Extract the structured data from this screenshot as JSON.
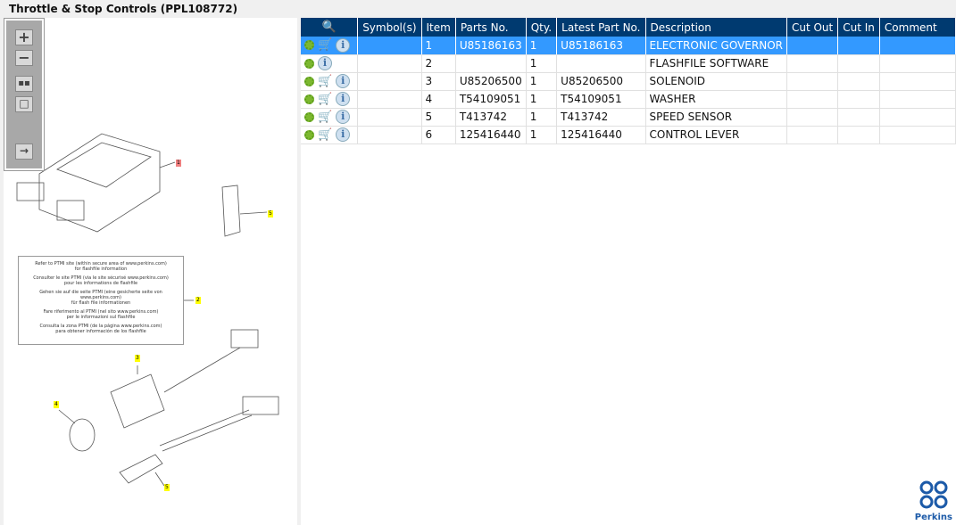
{
  "title": "Throttle & Stop Controls (PPL108772)",
  "toolbar": {
    "zoom_in": "zoom-in",
    "zoom_out": "zoom-out",
    "fit": "fit-all",
    "actual": "actual-size",
    "export": "export"
  },
  "diagram": {
    "callouts": [
      "1",
      "5",
      "2",
      "3",
      "4",
      "5"
    ],
    "note": [
      "Refer to PTMI site (within secure area of www.perkins.com)",
      "for flashfile information",
      "Consulter le site PTMI (via le site sécurisé www.perkins.com)",
      "pour les informations de flashfile",
      "Gehen sie auf die seite PTMI (eine gesicherte seite von www.perkins.com)",
      "für flash file informationen",
      "Fare riferimento al PTMI (nel sito www.perkins.com)",
      "per le informazioni sul flashfile",
      "Consulta la zona PTMI (de la página www.perkins.com)",
      "para obtener información de los flashfile"
    ]
  },
  "grid": {
    "columns": [
      "",
      "Symbol(s)",
      "Item",
      "Parts No.",
      "Qty.",
      "Latest Part No.",
      "Description",
      "Cut Out",
      "Cut In",
      "Comment"
    ],
    "rows": [
      {
        "item": "1",
        "part": "U85186163",
        "qty": "1",
        "latest": "U85186163",
        "desc": "ELECTRONIC GOVERNOR",
        "cart": true,
        "selected": true
      },
      {
        "item": "2",
        "part": "",
        "qty": "1",
        "latest": "",
        "desc": "FLASHFILE SOFTWARE",
        "cart": false
      },
      {
        "item": "3",
        "part": "U85206500",
        "qty": "1",
        "latest": "U85206500",
        "desc": "SOLENOID",
        "cart": true
      },
      {
        "item": "4",
        "part": "T54109051",
        "qty": "1",
        "latest": "T54109051",
        "desc": "WASHER",
        "cart": true
      },
      {
        "item": "5",
        "part": "T413742",
        "qty": "1",
        "latest": "T413742",
        "desc": "SPEED SENSOR",
        "cart": true
      },
      {
        "item": "6",
        "part": "125416440",
        "qty": "1",
        "latest": "125416440",
        "desc": "CONTROL LEVER",
        "cart": true
      }
    ]
  },
  "logo": "Perkins",
  "colors": {
    "header": "#003a70",
    "selected": "#3399ff",
    "callout": "#ffff00",
    "callout_selected": "#f08080"
  }
}
